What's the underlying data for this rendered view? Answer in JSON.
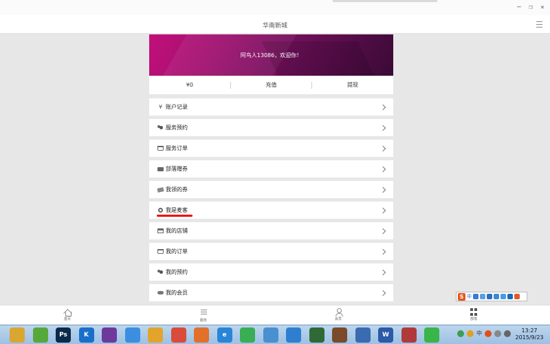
{
  "window": {
    "title": "华南新城",
    "controls": [
      "─",
      "❐",
      "✕"
    ]
  },
  "banner": {
    "welcome": "阿鸟人13086，欢迎你！"
  },
  "balance": {
    "amount": "¥0",
    "recharge": "充值",
    "withdraw": "提现"
  },
  "menu": [
    {
      "label": "账户记录",
      "icon": "yen-icon"
    },
    {
      "label": "服务预约",
      "icon": "users-icon"
    },
    {
      "label": "服务订单",
      "icon": "cart-icon"
    },
    {
      "label": "部落赠券",
      "icon": "ticket-icon"
    },
    {
      "label": "我领的券",
      "icon": "coupon-icon"
    },
    {
      "label": "我是麦客",
      "icon": "gear-icon"
    },
    {
      "label": "我的店铺",
      "icon": "store-icon"
    },
    {
      "label": "我的订单",
      "icon": "cart-icon"
    },
    {
      "label": "我的预约",
      "icon": "users-icon"
    },
    {
      "label": "我的会员",
      "icon": "handshake-icon"
    }
  ],
  "bottom_nav": [
    {
      "label": "首页",
      "icon": "home-icon"
    },
    {
      "label": "服务",
      "icon": "list-icon"
    },
    {
      "label": "会员",
      "icon": "user-icon"
    },
    {
      "label": "部落",
      "icon": "grid-icon"
    }
  ],
  "ime": {
    "logo": "S",
    "mode": "中"
  },
  "taskbar": {
    "apps": [
      {
        "name": "file-explorer-icon",
        "glyph": "",
        "color": "#d9a631"
      },
      {
        "name": "leaf-app-icon",
        "glyph": "",
        "color": "#57a83a"
      },
      {
        "name": "photoshop-icon",
        "glyph": "Ps",
        "color": "#0b2a4a"
      },
      {
        "name": "k-app-icon",
        "glyph": "K",
        "color": "#1a6fc9"
      },
      {
        "name": "orb-app-icon",
        "glyph": "",
        "color": "#6d3a9c"
      },
      {
        "name": "pen-app-icon",
        "glyph": "",
        "color": "#3a8fe0"
      },
      {
        "name": "shield-app-icon",
        "glyph": "",
        "color": "#e3a42b"
      },
      {
        "name": "chrome-icon",
        "glyph": "",
        "color": "#d94b3a"
      },
      {
        "name": "firefox-icon",
        "glyph": "",
        "color": "#e0702a"
      },
      {
        "name": "ie-icon",
        "glyph": "e",
        "color": "#2a85d6"
      },
      {
        "name": "green-arrow-icon",
        "glyph": "",
        "color": "#3aae54"
      },
      {
        "name": "cloud-app-icon",
        "glyph": "",
        "color": "#4a8fd0"
      },
      {
        "name": "network-app-icon",
        "glyph": "",
        "color": "#2f7fd0"
      },
      {
        "name": "eye-app-icon",
        "glyph": "",
        "color": "#2f6a36"
      },
      {
        "name": "bug-app-icon",
        "glyph": "",
        "color": "#7a4a2a"
      },
      {
        "name": "remote-app-icon",
        "glyph": "",
        "color": "#3a6ab0"
      },
      {
        "name": "word-icon",
        "glyph": "W",
        "color": "#2a5aa8"
      },
      {
        "name": "house-app-icon",
        "glyph": "",
        "color": "#b03a3a"
      },
      {
        "name": "wechat-icon",
        "glyph": "",
        "color": "#3ab54a"
      }
    ],
    "tray_text": "中",
    "time": "13:27",
    "date": "2015/9/23"
  }
}
